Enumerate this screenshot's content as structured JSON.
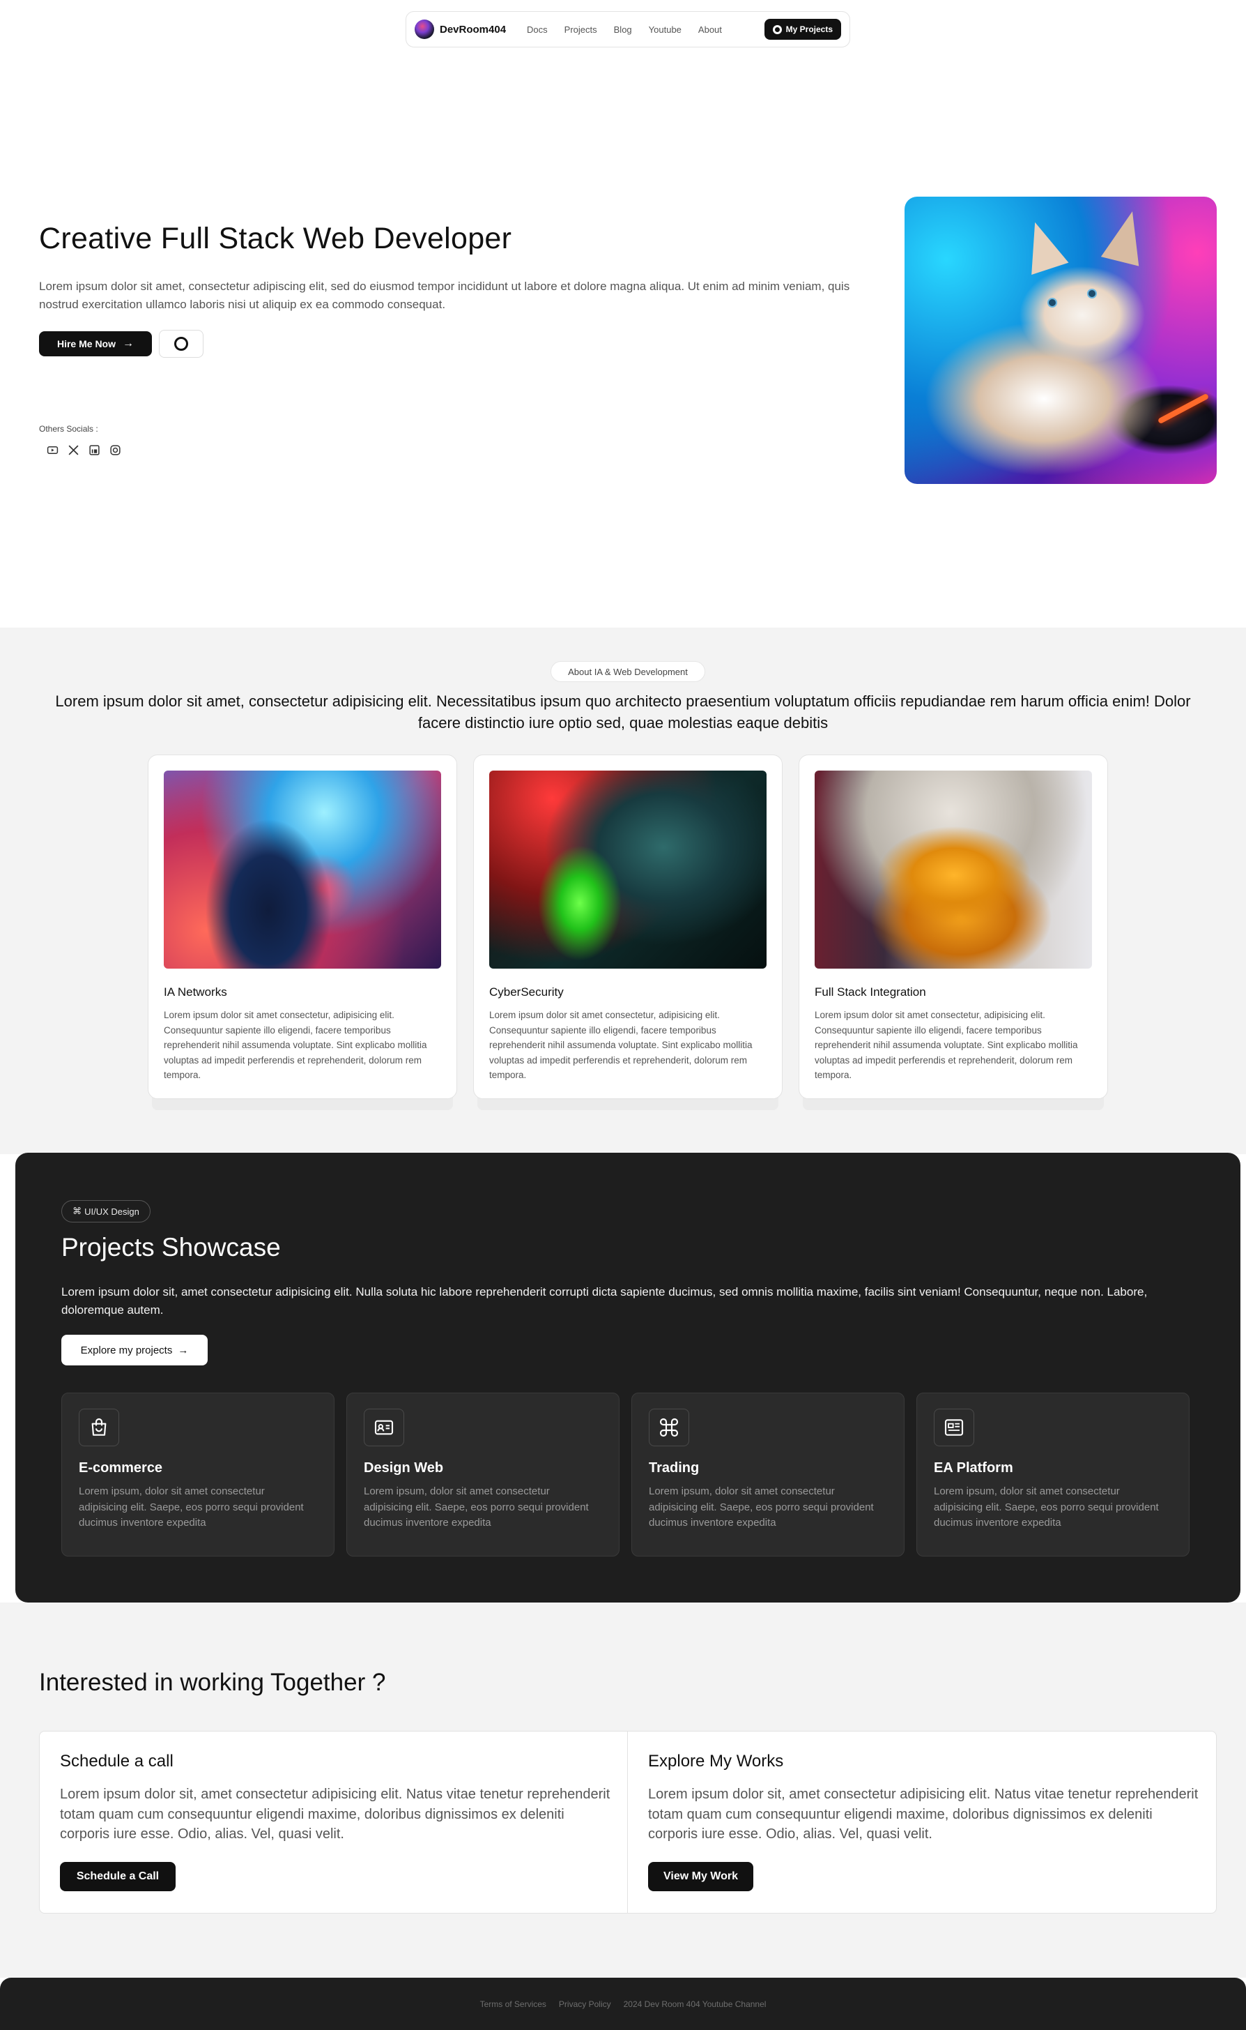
{
  "nav": {
    "brand": "DevRoom404",
    "links": [
      "Docs",
      "Projects",
      "Blog",
      "Youtube",
      "About"
    ],
    "cta": "My Projects"
  },
  "hero": {
    "title": "Creative Full Stack Web Developer",
    "description": "Lorem ipsum dolor sit amet, consectetur adipiscing elit, sed do eiusmod tempor incididunt ut labore et dolore magna aliqua. Ut enim ad minim veniam, quis nostrud exercitation ullamco laboris nisi ut aliquip ex ea commodo consequat.",
    "hire_button": "Hire Me Now",
    "socials_label": "Others Socials :",
    "socials": [
      "youtube-icon",
      "x-icon",
      "linkedin-icon",
      "instagram-icon"
    ]
  },
  "about": {
    "tag": "About IA & Web Development",
    "text": "Lorem ipsum dolor sit amet, consectetur adipisicing elit. Necessitatibus ipsum quo architecto praesentium voluptatum officiis repudiandae rem harum officia enim! Dolor facere distinctio iure optio sed, quae molestias eaque debitis",
    "cards": [
      {
        "title": "IA Networks",
        "description": "Lorem ipsum dolor sit amet consectetur, adipisicing elit. Consequuntur sapiente illo eligendi, facere temporibus reprehenderit nihil assumenda voluptate. Sint explicabo mollitia voluptas ad impedit perferendis et reprehenderit, dolorum rem tempora."
      },
      {
        "title": "CyberSecurity",
        "description": "Lorem ipsum dolor sit amet consectetur, adipisicing elit. Consequuntur sapiente illo eligendi, facere temporibus reprehenderit nihil assumenda voluptate. Sint explicabo mollitia voluptas ad impedit perferendis et reprehenderit, dolorum rem tempora."
      },
      {
        "title": "Full Stack Integration",
        "description": "Lorem ipsum dolor sit amet consectetur, adipisicing elit. Consequuntur sapiente illo eligendi, facere temporibus reprehenderit nihil assumenda voluptate. Sint explicabo mollitia voluptas ad impedit perferendis et reprehenderit, dolorum rem tempora."
      }
    ]
  },
  "projects": {
    "tag": "UI/UX Design",
    "title": "Projects Showcase",
    "description": "Lorem ipsum dolor sit, amet consectetur adipisicing elit. Nulla soluta hic labore reprehenderit corrupti dicta sapiente ducimus, sed omnis mollitia maxime, facilis sint veniam! Consequuntur, neque non. Labore, doloremque autem.",
    "explore_button": "Explore my projects",
    "cards": [
      {
        "title": "E-commerce",
        "icon": "shopping-bag-icon",
        "description": "Lorem ipsum, dolor sit amet consectetur adipisicing elit. Saepe, eos porro sequi provident ducimus inventore expedita"
      },
      {
        "title": "Design Web",
        "icon": "id-card-icon",
        "description": "Lorem ipsum, dolor sit amet consectetur adipisicing elit. Saepe, eos porro sequi provident ducimus inventore expedita"
      },
      {
        "title": "Trading",
        "icon": "command-icon",
        "description": "Lorem ipsum, dolor sit amet consectetur adipisicing elit. Saepe, eos porro sequi provident ducimus inventore expedita"
      },
      {
        "title": "EA Platform",
        "icon": "news-icon",
        "description": "Lorem ipsum, dolor sit amet consectetur adipisicing elit. Saepe, eos porro sequi provident ducimus inventore expedita"
      }
    ]
  },
  "collab": {
    "title": "Interested in working Together ?",
    "left": {
      "title": "Schedule a call",
      "description": "Lorem ipsum dolor sit, amet consectetur adipisicing elit. Natus vitae tenetur reprehenderit totam quam cum consequuntur eligendi maxime, doloribus dignissimos ex deleniti corporis iure esse. Odio, alias. Vel, quasi velit.",
      "button": "Schedule a Call"
    },
    "right": {
      "title": "Explore My Works",
      "description": "Lorem ipsum dolor sit, amet consectetur adipisicing elit. Natus vitae tenetur reprehenderit totam quam cum consequuntur eligendi maxime, doloribus dignissimos ex deleniti corporis iure esse. Odio, alias. Vel, quasi velit.",
      "button": "View My Work"
    }
  },
  "footer": {
    "links": [
      "Terms of Services",
      "Privacy Policy",
      "2024 Dev Room 404 Youtube Channel"
    ]
  }
}
